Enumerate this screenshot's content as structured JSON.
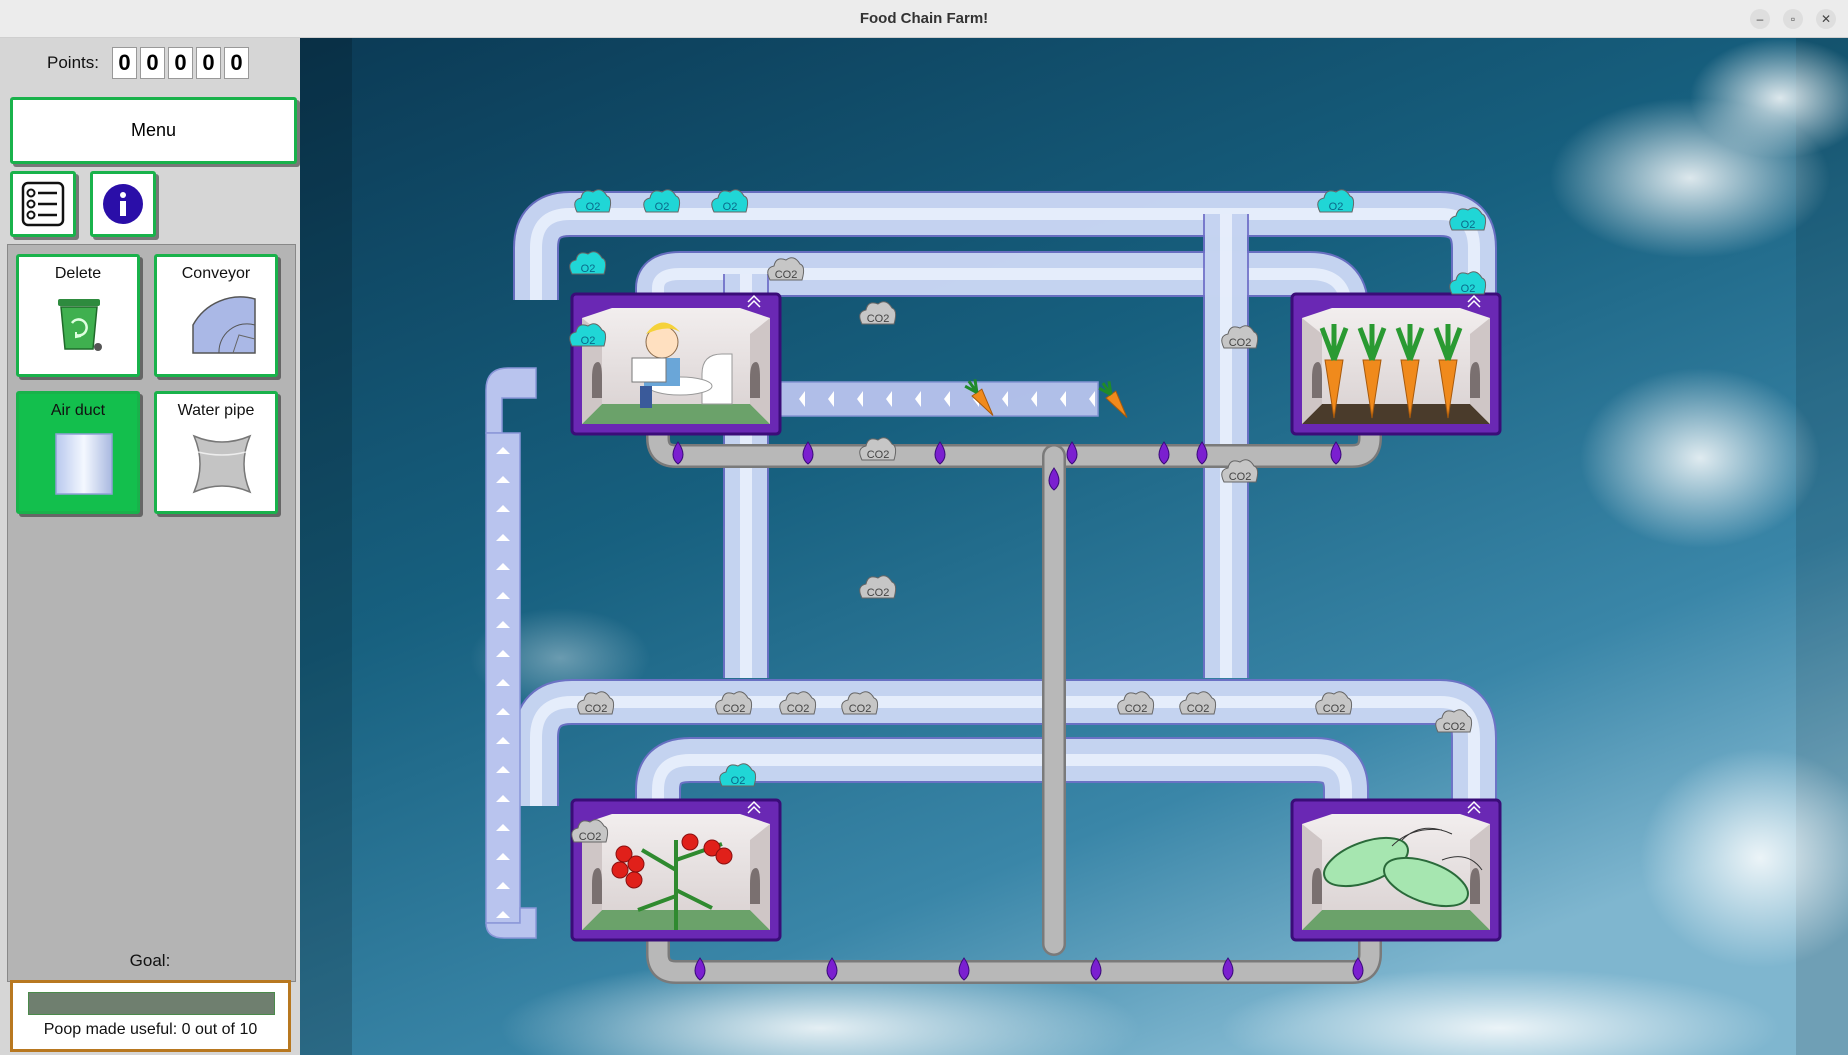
{
  "window": {
    "title": "Food Chain Farm!"
  },
  "sidebar": {
    "points_label": "Points:",
    "points_digits": [
      "0",
      "0",
      "0",
      "0",
      "0"
    ],
    "menu_label": "Menu",
    "tools": [
      {
        "label": "Delete"
      },
      {
        "label": "Conveyor"
      },
      {
        "label": "Air duct",
        "selected": true
      },
      {
        "label": "Water pipe"
      }
    ],
    "goal_label": "Goal:",
    "goal_text": "Poop made useful: 0 out of 10",
    "goal_progress": 0
  },
  "board": {
    "tokens": {
      "o2": "O2",
      "co2": "CO2"
    },
    "colors": {
      "pipe": "#c9d8f2",
      "pipe_border": "#7070c8",
      "water_pipe": "#b8b8b8",
      "droplet": "#7b1fd0",
      "o2": "#20d6d6",
      "co2": "#c6c6c6",
      "room": "#6a28b4"
    }
  }
}
